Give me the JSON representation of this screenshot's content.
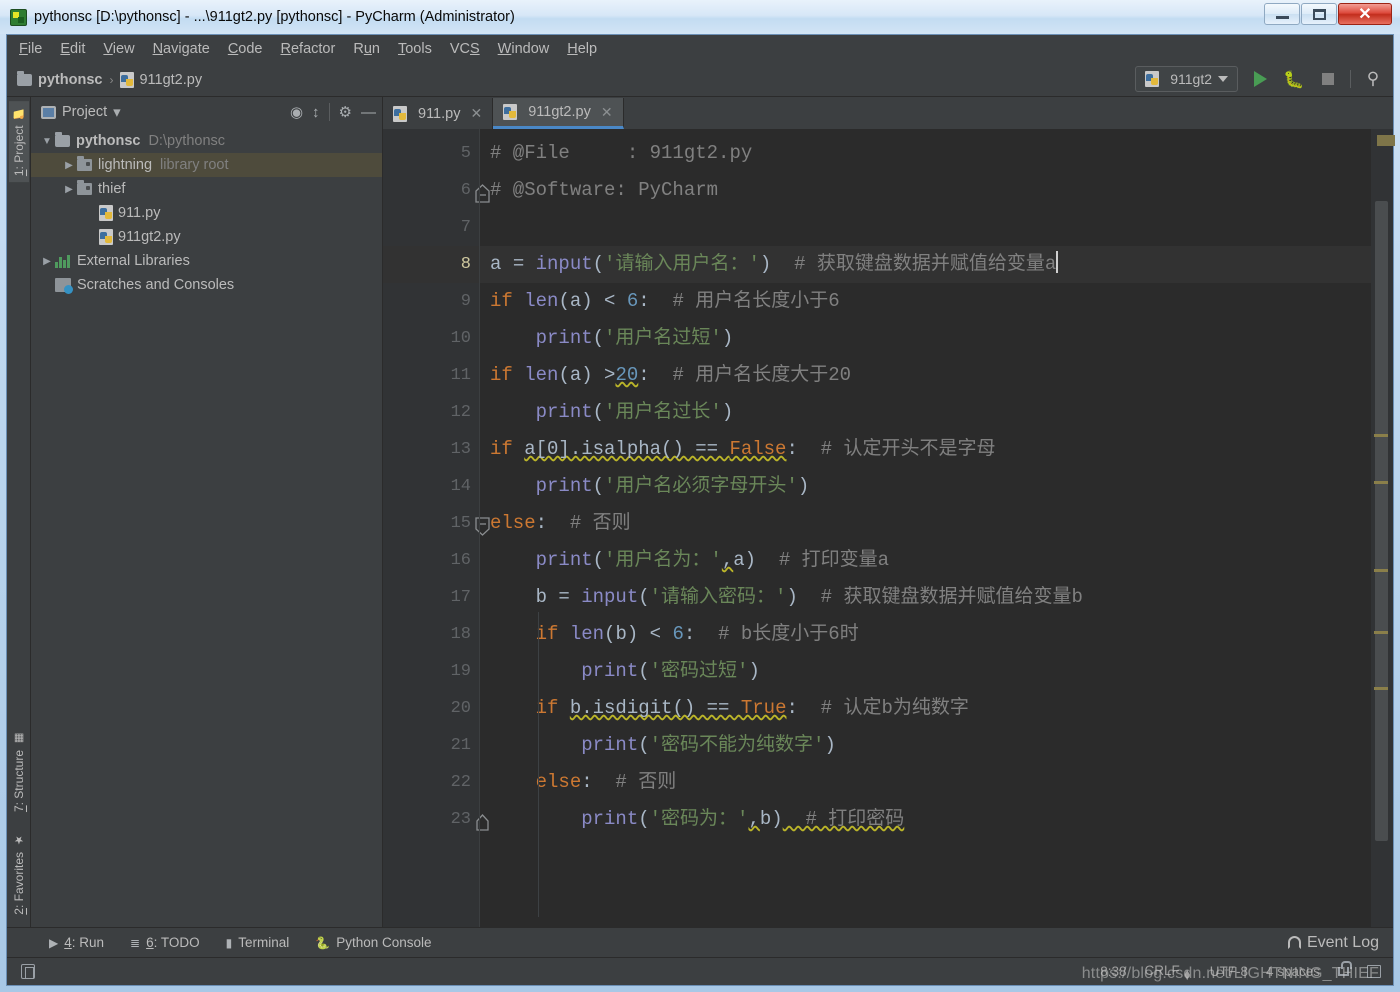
{
  "window": {
    "title": "pythonsc [D:\\pythonsc] - ...\\911gt2.py [pythonsc] - PyCharm (Administrator)",
    "app_icon": "pycharm-icon",
    "minimize_label": "",
    "maximize_label": "",
    "close_label": "✕"
  },
  "menubar": {
    "items": [
      {
        "label": "File",
        "mnemonic": "F"
      },
      {
        "label": "Edit",
        "mnemonic": "E"
      },
      {
        "label": "View",
        "mnemonic": "V"
      },
      {
        "label": "Navigate",
        "mnemonic": "N"
      },
      {
        "label": "Code",
        "mnemonic": "C"
      },
      {
        "label": "Refactor",
        "mnemonic": "R"
      },
      {
        "label": "Run",
        "mnemonic": "u"
      },
      {
        "label": "Tools",
        "mnemonic": "T"
      },
      {
        "label": "VCS",
        "mnemonic": "S"
      },
      {
        "label": "Window",
        "mnemonic": "W"
      },
      {
        "label": "Help",
        "mnemonic": "H"
      }
    ]
  },
  "navbar": {
    "breadcrumb": [
      {
        "label": "pythonsc",
        "icon": "folder-icon"
      },
      {
        "label": "911gt2.py",
        "icon": "python-file-icon"
      }
    ],
    "separator": "›",
    "run_config": {
      "label": "911gt2",
      "icon": "python-icon"
    },
    "run_button": "run-icon",
    "debug_button": "debug-icon",
    "stop_button": "stop-icon",
    "search_button": "⌕"
  },
  "left_strip": {
    "top": [
      {
        "label": "1: Project",
        "mnemonic": "1",
        "icon": "folder-icon",
        "active": true
      }
    ],
    "bottom": [
      {
        "label": "7: Structure",
        "mnemonic": "7",
        "icon": "structure-icon"
      },
      {
        "label": "2: Favorites",
        "mnemonic": "2",
        "icon": "star-icon"
      }
    ]
  },
  "project_panel": {
    "title": "Project",
    "dropdown": "▼",
    "toolbar_icons": [
      "locate-icon",
      "collapse-all-icon",
      "settings-gear-icon",
      "minimize-icon"
    ],
    "tree": [
      {
        "indent": 0,
        "arrow": "open",
        "icon": "folder-icon",
        "label": "pythonsc",
        "bold": true,
        "sub": "D:\\pythonsc",
        "selected": false
      },
      {
        "indent": 1,
        "arrow": "closed",
        "icon": "module-folder-icon",
        "label": "lightning",
        "bold": false,
        "sub": "library root",
        "selected": true
      },
      {
        "indent": 1,
        "arrow": "closed",
        "icon": "module-folder-icon",
        "label": "thief",
        "bold": false,
        "sub": "",
        "selected": false
      },
      {
        "indent": 2,
        "arrow": "none",
        "icon": "python-file-icon",
        "label": "911.py",
        "bold": false,
        "sub": "",
        "selected": false
      },
      {
        "indent": 2,
        "arrow": "none",
        "icon": "python-file-icon",
        "label": "911gt2.py",
        "bold": false,
        "sub": "",
        "selected": false
      },
      {
        "indent": 0,
        "arrow": "closed",
        "icon": "external-libraries-icon",
        "label": "External Libraries",
        "bold": false,
        "sub": "",
        "selected": false
      },
      {
        "indent": 0,
        "arrow": "none",
        "icon": "scratches-icon",
        "label": "Scratches and Consoles",
        "bold": false,
        "sub": "",
        "selected": false
      }
    ]
  },
  "editor": {
    "tabs": [
      {
        "label": "911.py",
        "icon": "python-file-icon",
        "active": false,
        "close": "✕"
      },
      {
        "label": "911gt2.py",
        "icon": "python-file-icon",
        "active": true,
        "close": "✕"
      }
    ],
    "first_line_number": 5,
    "current_line": 8,
    "lines": [
      {
        "n": 5,
        "fold": "",
        "tokens": [
          {
            "t": "cmt",
            "v": "# @File     : 911gt2.py"
          }
        ]
      },
      {
        "n": 6,
        "fold": "end",
        "tokens": [
          {
            "t": "cmt",
            "v": "# @Software: PyCharm"
          }
        ]
      },
      {
        "n": 7,
        "fold": "",
        "tokens": []
      },
      {
        "n": 8,
        "fold": "",
        "current": true,
        "tokens": [
          {
            "t": "id",
            "v": "a "
          },
          {
            "t": "op",
            "v": "= "
          },
          {
            "t": "fn",
            "v": "input"
          },
          {
            "t": "op",
            "v": "("
          },
          {
            "t": "str",
            "v": "'请输入用户名：'"
          },
          {
            "t": "op",
            "v": ")"
          },
          {
            "t": "cmt",
            "v": "  # 获取键盘数据并赋值给变量a"
          },
          {
            "t": "caret",
            "v": ""
          }
        ]
      },
      {
        "n": 9,
        "fold": "",
        "tokens": [
          {
            "t": "kw",
            "v": "if "
          },
          {
            "t": "fn",
            "v": "len"
          },
          {
            "t": "op",
            "v": "(a) < "
          },
          {
            "t": "num",
            "v": "6"
          },
          {
            "t": "op",
            "v": ":"
          },
          {
            "t": "cmt",
            "v": "  # 用户名长度小于6"
          }
        ]
      },
      {
        "n": 10,
        "fold": "",
        "tokens": [
          {
            "t": "op",
            "v": "    "
          },
          {
            "t": "fn",
            "v": "print"
          },
          {
            "t": "op",
            "v": "("
          },
          {
            "t": "str",
            "v": "'用户名过短'"
          },
          {
            "t": "op",
            "v": ")"
          }
        ]
      },
      {
        "n": 11,
        "fold": "",
        "tokens": [
          {
            "t": "kw",
            "v": "if "
          },
          {
            "t": "fn",
            "v": "len"
          },
          {
            "t": "op",
            "v": "(a) >"
          },
          {
            "t": "num sq",
            "v": "20"
          },
          {
            "t": "op",
            "v": ":"
          },
          {
            "t": "cmt",
            "v": "  # 用户名长度大于20"
          }
        ]
      },
      {
        "n": 12,
        "fold": "",
        "tokens": [
          {
            "t": "op",
            "v": "    "
          },
          {
            "t": "fn",
            "v": "print"
          },
          {
            "t": "op",
            "v": "("
          },
          {
            "t": "str",
            "v": "'用户名过长'"
          },
          {
            "t": "op",
            "v": ")"
          }
        ]
      },
      {
        "n": 13,
        "fold": "",
        "tokens": [
          {
            "t": "kw",
            "v": "if "
          },
          {
            "t": "op sq",
            "v": "a[0].isalpha() == "
          },
          {
            "t": "kw sq",
            "v": "False"
          },
          {
            "t": "op",
            "v": ":"
          },
          {
            "t": "cmt",
            "v": "  # 认定开头不是字母"
          }
        ]
      },
      {
        "n": 14,
        "fold": "",
        "tokens": [
          {
            "t": "op",
            "v": "    "
          },
          {
            "t": "fn",
            "v": "print"
          },
          {
            "t": "op",
            "v": "("
          },
          {
            "t": "str",
            "v": "'用户名必须字母开头'"
          },
          {
            "t": "op",
            "v": ")"
          }
        ]
      },
      {
        "n": 15,
        "fold": "start",
        "tokens": [
          {
            "t": "kw",
            "v": "else"
          },
          {
            "t": "op",
            "v": ":"
          },
          {
            "t": "cmt",
            "v": "  # 否则"
          }
        ]
      },
      {
        "n": 16,
        "fold": "",
        "tokens": [
          {
            "t": "op",
            "v": "    "
          },
          {
            "t": "fn",
            "v": "print"
          },
          {
            "t": "op",
            "v": "("
          },
          {
            "t": "str",
            "v": "'用户名为：'"
          },
          {
            "t": "op sq",
            "v": ","
          },
          {
            "t": "op",
            "v": "a)"
          },
          {
            "t": "cmt",
            "v": "  # 打印变量a"
          }
        ]
      },
      {
        "n": 17,
        "fold": "",
        "tokens": [
          {
            "t": "op",
            "v": "    b = "
          },
          {
            "t": "fn",
            "v": "input"
          },
          {
            "t": "op",
            "v": "("
          },
          {
            "t": "str",
            "v": "'请输入密码：'"
          },
          {
            "t": "op",
            "v": ")"
          },
          {
            "t": "cmt",
            "v": "  # 获取键盘数据并赋值给变量b"
          }
        ]
      },
      {
        "n": 18,
        "fold": "",
        "tokens": [
          {
            "t": "op",
            "v": "    "
          },
          {
            "t": "kw",
            "v": "if "
          },
          {
            "t": "fn",
            "v": "len"
          },
          {
            "t": "op",
            "v": "(b) < "
          },
          {
            "t": "num",
            "v": "6"
          },
          {
            "t": "op",
            "v": ":"
          },
          {
            "t": "cmt",
            "v": "  # b长度小于6时"
          }
        ]
      },
      {
        "n": 19,
        "fold": "",
        "tokens": [
          {
            "t": "op",
            "v": "        "
          },
          {
            "t": "fn",
            "v": "print"
          },
          {
            "t": "op",
            "v": "("
          },
          {
            "t": "str",
            "v": "'密码过短'"
          },
          {
            "t": "op",
            "v": ")"
          }
        ]
      },
      {
        "n": 20,
        "fold": "",
        "tokens": [
          {
            "t": "op",
            "v": "    "
          },
          {
            "t": "kw",
            "v": "if "
          },
          {
            "t": "op sq",
            "v": "b.isdigit() == "
          },
          {
            "t": "kw sq",
            "v": "True"
          },
          {
            "t": "op",
            "v": ":"
          },
          {
            "t": "cmt",
            "v": "  # 认定b为纯数字"
          }
        ]
      },
      {
        "n": 21,
        "fold": "",
        "tokens": [
          {
            "t": "op",
            "v": "        "
          },
          {
            "t": "fn",
            "v": "print"
          },
          {
            "t": "op",
            "v": "("
          },
          {
            "t": "str",
            "v": "'密码不能为纯数字'"
          },
          {
            "t": "op",
            "v": ")"
          }
        ]
      },
      {
        "n": 22,
        "fold": "",
        "tokens": [
          {
            "t": "op",
            "v": "    "
          },
          {
            "t": "kw",
            "v": "else"
          },
          {
            "t": "op",
            "v": ":"
          },
          {
            "t": "cmt",
            "v": "  # 否则"
          }
        ]
      },
      {
        "n": 23,
        "fold": "end2",
        "tokens": [
          {
            "t": "op",
            "v": "        "
          },
          {
            "t": "fn",
            "v": "print"
          },
          {
            "t": "op",
            "v": "("
          },
          {
            "t": "str",
            "v": "'密码为：'"
          },
          {
            "t": "op sq",
            "v": ","
          },
          {
            "t": "op",
            "v": "b)"
          },
          {
            "t": "cmt sq",
            "v": "  # 打印密码"
          }
        ]
      }
    ]
  },
  "bottom_bar": {
    "items": [
      {
        "label": "4: Run",
        "mnemonic": "4",
        "icon": "run-icon"
      },
      {
        "label": "6: TODO",
        "mnemonic": "6",
        "icon": "todo-icon"
      },
      {
        "label": "Terminal",
        "mnemonic": "",
        "icon": "terminal-icon"
      },
      {
        "label": "Python Console",
        "mnemonic": "",
        "icon": "python-console-icon"
      }
    ],
    "event_log": "Event Log"
  },
  "statusbar": {
    "caret_position": "8:38",
    "line_separator": "CRLF",
    "encoding": "UTF-8",
    "indent": "4 spaces",
    "lock_icon": "lock-icon",
    "hidden_icon": "hide-windows-icon",
    "watermark": "https://blog.csdn.net/LIGHTNING_THIEF"
  },
  "colors": {
    "editor_bg": "#2b2b2b",
    "panel_bg": "#3c3f41",
    "keyword": "#cc7832",
    "function": "#8a8ac6",
    "string": "#6a8759",
    "number": "#6897bb",
    "comment": "#808080",
    "selection": "#4e4b3c",
    "tab_accent": "#4a88c7",
    "warning_marker": "#8a7f4a"
  }
}
